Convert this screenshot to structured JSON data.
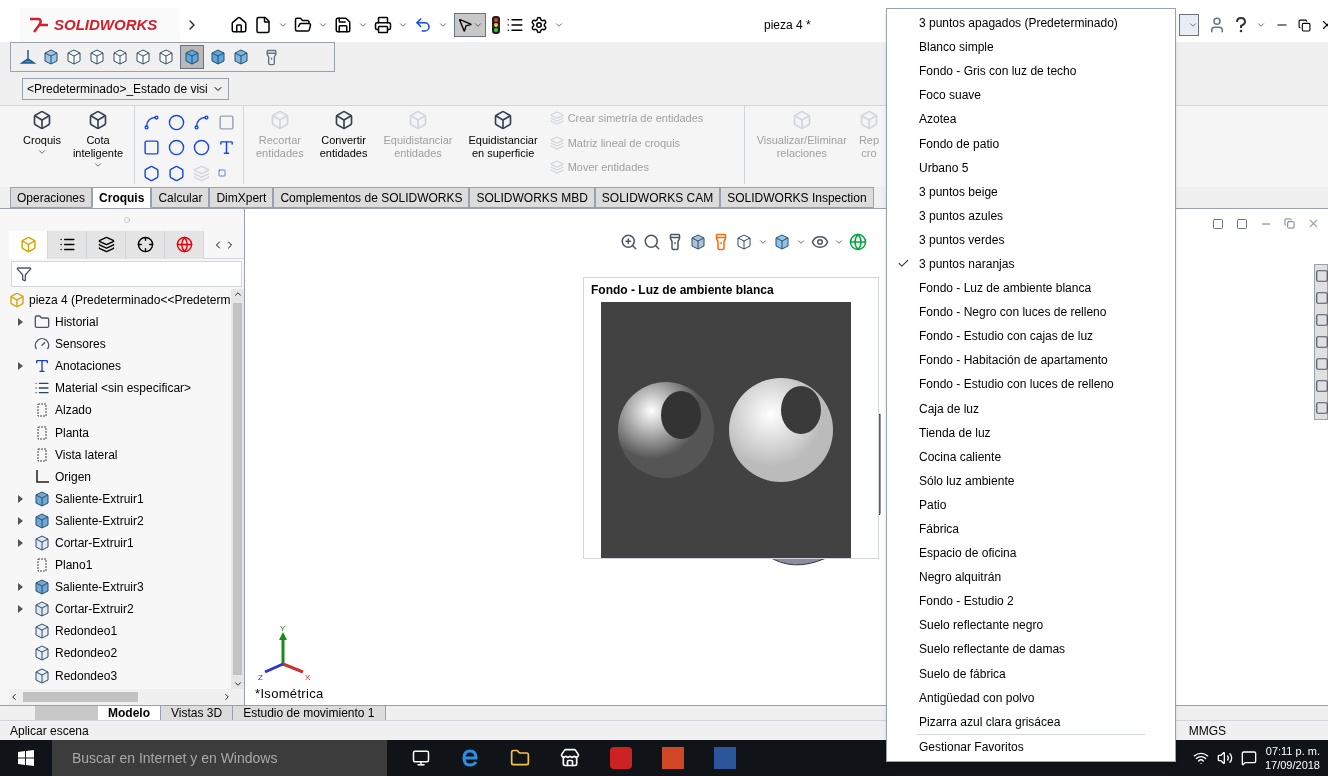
{
  "app": {
    "logo": "SOLIDWORKS",
    "title": "pieza 4 *"
  },
  "display_state": "<Predeterminado>_Estado de visi",
  "ribbon": {
    "sketch": [
      {
        "lines": [
          "Croquis"
        ],
        "disabled": false
      },
      {
        "lines": [
          "Cota",
          "inteligente"
        ],
        "disabled": false
      }
    ],
    "edit": [
      {
        "lines": [
          "Recortar",
          "entidades"
        ],
        "disabled": true
      },
      {
        "lines": [
          "Convertir",
          "entidades"
        ],
        "disabled": false
      },
      {
        "lines": [
          "Equidistanciar",
          "entidades"
        ],
        "disabled": true
      },
      {
        "lines": [
          "Equidistanciar",
          "en superficie"
        ],
        "disabled": false
      }
    ],
    "list": [
      {
        "label": "Crear simetría de entidades",
        "disabled": true
      },
      {
        "label": "Matriz lineal de croquis",
        "disabled": true
      },
      {
        "label": "Mover entidades",
        "disabled": true
      }
    ],
    "relations": [
      {
        "lines": [
          "Visualizar/Eliminar",
          "relaciones"
        ],
        "disabled": true
      },
      {
        "lines": [
          "Rep",
          "cro"
        ],
        "disabled": true
      }
    ]
  },
  "command_tabs": [
    {
      "label": "Operaciones",
      "selected": false
    },
    {
      "label": "Croquis",
      "selected": true
    },
    {
      "label": "Calcular",
      "selected": false
    },
    {
      "label": "DimXpert",
      "selected": false
    },
    {
      "label": "Complementos de SOLIDWORKS",
      "selected": false
    },
    {
      "label": "SOLIDWORKS MBD",
      "selected": false
    },
    {
      "label": "SOLIDWORKS CAM",
      "selected": false
    },
    {
      "label": "SOLIDWORKS Inspection",
      "selected": false
    }
  ],
  "panel_tabs": [
    {
      "selected": true
    },
    {
      "selected": false
    },
    {
      "selected": false
    },
    {
      "selected": false
    },
    {
      "selected": false
    }
  ],
  "tree": {
    "root": "pieza 4  (Predeterminado<<Predeterm",
    "items": [
      {
        "label": "Historial",
        "kind": "history",
        "expandable": true
      },
      {
        "label": "Sensores",
        "kind": "sensor",
        "expandable": false
      },
      {
        "label": "Anotaciones",
        "kind": "annotation",
        "expandable": true
      },
      {
        "label": "Material <sin especificar>",
        "kind": "material",
        "expandable": false
      },
      {
        "label": "Alzado",
        "kind": "plane",
        "expandable": false
      },
      {
        "label": "Planta",
        "kind": "plane",
        "expandable": false
      },
      {
        "label": "Vista lateral",
        "kind": "plane",
        "expandable": false
      },
      {
        "label": "Origen",
        "kind": "origin",
        "expandable": false
      },
      {
        "label": "Saliente-Extruir1",
        "kind": "boss",
        "expandable": true
      },
      {
        "label": "Saliente-Extruir2",
        "kind": "boss",
        "expandable": true
      },
      {
        "label": "Cortar-Extruir1",
        "kind": "cut",
        "expandable": true
      },
      {
        "label": "Plano1",
        "kind": "plane",
        "expandable": false
      },
      {
        "label": "Saliente-Extruir3",
        "kind": "boss",
        "expandable": true
      },
      {
        "label": "Cortar-Extruir2",
        "kind": "cut",
        "expandable": true
      },
      {
        "label": "Redondeo1",
        "kind": "fillet",
        "expandable": false
      },
      {
        "label": "Redondeo2",
        "kind": "fillet",
        "expandable": false
      },
      {
        "label": "Redondeo3",
        "kind": "fillet",
        "expandable": false
      }
    ]
  },
  "viewport": {
    "view_label": "*Isométrica",
    "axes": {
      "y": "Y",
      "z": "Z",
      "x": "X"
    }
  },
  "preview": {
    "title": "Fondo - Luz de ambiente blanca"
  },
  "scene_menu": {
    "items": [
      {
        "label": "3 puntos apagados  (Predeterminado)",
        "checked": false
      },
      {
        "label": "Blanco simple",
        "checked": false
      },
      {
        "label": "Fondo - Gris con luz de techo",
        "checked": false
      },
      {
        "label": "Foco suave",
        "checked": false
      },
      {
        "label": "Azotea",
        "checked": false
      },
      {
        "label": "Fondo de patio",
        "checked": false
      },
      {
        "label": "Urbano 5",
        "checked": false
      },
      {
        "label": "3 puntos beige",
        "checked": false
      },
      {
        "label": "3 puntos azules",
        "checked": false
      },
      {
        "label": "3 puntos verdes",
        "checked": false
      },
      {
        "label": "3 puntos naranjas",
        "checked": true
      },
      {
        "label": "Fondo - Luz de ambiente blanca",
        "checked": false
      },
      {
        "label": "Fondo - Negro con luces de relleno",
        "checked": false
      },
      {
        "label": "Fondo - Estudio con cajas de luz",
        "checked": false
      },
      {
        "label": "Fondo - Habitación de apartamento",
        "checked": false
      },
      {
        "label": "Fondo - Estudio con luces de relleno",
        "checked": false
      },
      {
        "label": "Caja de luz",
        "checked": false
      },
      {
        "label": "Tienda de luz",
        "checked": false
      },
      {
        "label": "Cocina caliente",
        "checked": false
      },
      {
        "label": "Sólo luz ambiente",
        "checked": false
      },
      {
        "label": "Patio",
        "checked": false
      },
      {
        "label": "Fábrica",
        "checked": false
      },
      {
        "label": "Espacio de oficina",
        "checked": false
      },
      {
        "label": "Negro alquitrán",
        "checked": false
      },
      {
        "label": "Fondo - Estudio 2",
        "checked": false
      },
      {
        "label": "Suelo reflectante negro",
        "checked": false
      },
      {
        "label": "Suelo reflectante de damas",
        "checked": false
      },
      {
        "label": "Suelo de fábrica",
        "checked": false
      },
      {
        "label": "Antigüedad con polvo",
        "checked": false
      },
      {
        "label": "Pizarra azul clara grisácea",
        "checked": false
      }
    ],
    "footer": "Gestionar Favoritos"
  },
  "bottom_tabs": [
    {
      "label": "Modelo",
      "selected": true
    },
    {
      "label": "Vistas 3D",
      "selected": false
    },
    {
      "label": "Estudio de movimiento 1",
      "selected": false
    }
  ],
  "status": {
    "message": "Aplicar escena",
    "units": "MMGS"
  },
  "taskbar": {
    "search_placeholder": "Buscar en Internet y en Windows",
    "time": "07:11 p. m.",
    "date": "17/09/2018"
  }
}
